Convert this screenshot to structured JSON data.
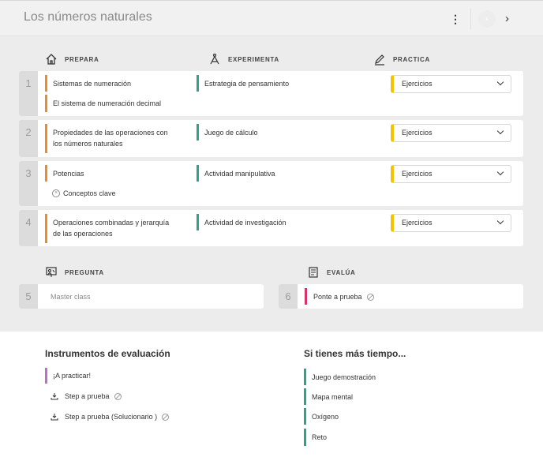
{
  "header": {
    "title": "Los números naturales",
    "menu_icon": "kebab-menu-icon",
    "next_icon": "chevron-right-icon"
  },
  "columns": {
    "prepara": "PREPARA",
    "experimenta": "EXPERIMENTA",
    "practica": "PRACTICA",
    "pregunta": "PREGUNTA",
    "evalua": "EVALÚA"
  },
  "rows": [
    {
      "num": "1",
      "prepara": [
        "Sistemas de numeración",
        "El sistema de numeración decimal"
      ],
      "experimenta": "Estrategia de pensamiento",
      "practica": "Ejercicios"
    },
    {
      "num": "2",
      "prepara": [
        "Propiedades de las operaciones con los números naturales"
      ],
      "experimenta": "Juego de cálculo",
      "practica": "Ejercicios"
    },
    {
      "num": "3",
      "prepara": [
        "Potencias"
      ],
      "concept": "Conceptos clave",
      "experimenta": "Actividad manipulativa",
      "practica": "Ejercicios"
    },
    {
      "num": "4",
      "prepara": [
        "Operaciones combinadas y jerarquía de las operaciones"
      ],
      "experimenta": "Actividad de investigación",
      "practica": "Ejercicios"
    }
  ],
  "pregunta": {
    "num": "5",
    "placeholder": "Master class"
  },
  "evalua": {
    "num": "6",
    "label": "Ponte a prueba"
  },
  "instrumentos": {
    "title": "Instrumentos de evaluación",
    "practicar": "¡A practicar!",
    "step": "Step a prueba",
    "step_sol": "Step a prueba (Solucionario )"
  },
  "mas_tiempo": {
    "title": "Si tienes más tiempo...",
    "items": [
      "Juego demostración",
      "Mapa mental",
      "Oxígeno",
      "Reto"
    ]
  },
  "colors": {
    "prepara": "#f0892c",
    "experimenta": "#2aa58a",
    "practica": "#f5c400",
    "evalua": "#d6336c",
    "practicar": "#b86fd0"
  }
}
